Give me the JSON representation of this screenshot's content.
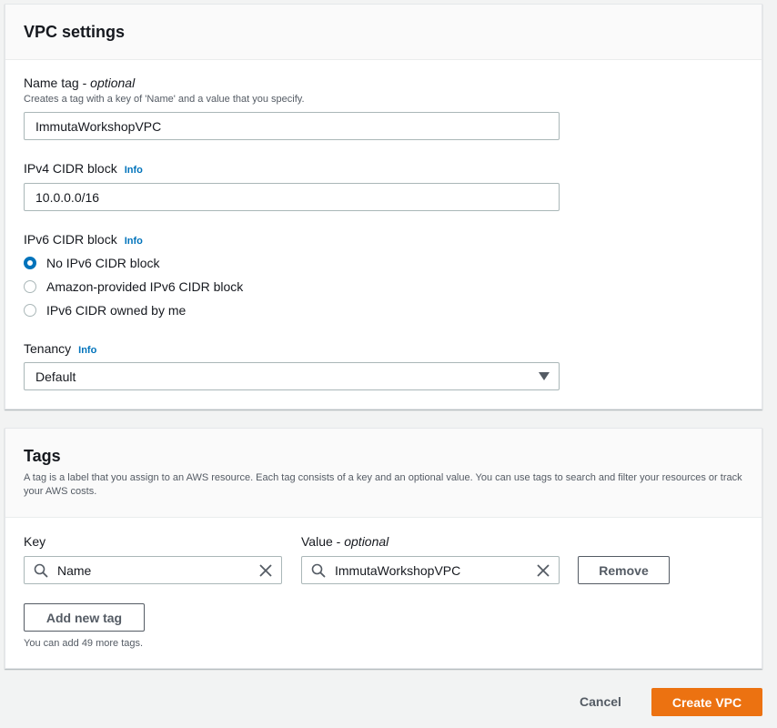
{
  "vpc_settings": {
    "title": "VPC settings",
    "name_tag": {
      "label": "Name tag",
      "optional": "optional",
      "description": "Creates a tag with a key of 'Name' and a value that you specify.",
      "value": "ImmutaWorkshopVPC"
    },
    "ipv4": {
      "label": "IPv4 CIDR block",
      "info": "Info",
      "value": "10.0.0.0/16"
    },
    "ipv6": {
      "label": "IPv6 CIDR block",
      "info": "Info",
      "options": [
        {
          "label": "No IPv6 CIDR block",
          "selected": true
        },
        {
          "label": "Amazon-provided IPv6 CIDR block",
          "selected": false
        },
        {
          "label": "IPv6 CIDR owned by me",
          "selected": false
        }
      ]
    },
    "tenancy": {
      "label": "Tenancy",
      "info": "Info",
      "value": "Default"
    }
  },
  "tags": {
    "title": "Tags",
    "description": "A tag is a label that you assign to an AWS resource. Each tag consists of a key and an optional value. You can use tags to search and filter your resources or track your AWS costs.",
    "key_label": "Key",
    "value_label": "Value",
    "value_optional": "optional",
    "rows": [
      {
        "key": "Name",
        "value": "ImmutaWorkshopVPC"
      }
    ],
    "remove_label": "Remove",
    "add_label": "Add new tag",
    "hint": "You can add 49 more tags."
  },
  "footer": {
    "cancel_label": "Cancel",
    "create_label": "Create VPC"
  },
  "colors": {
    "primary": "#ec7211",
    "link": "#0073bb",
    "border": "#aab7b8"
  }
}
